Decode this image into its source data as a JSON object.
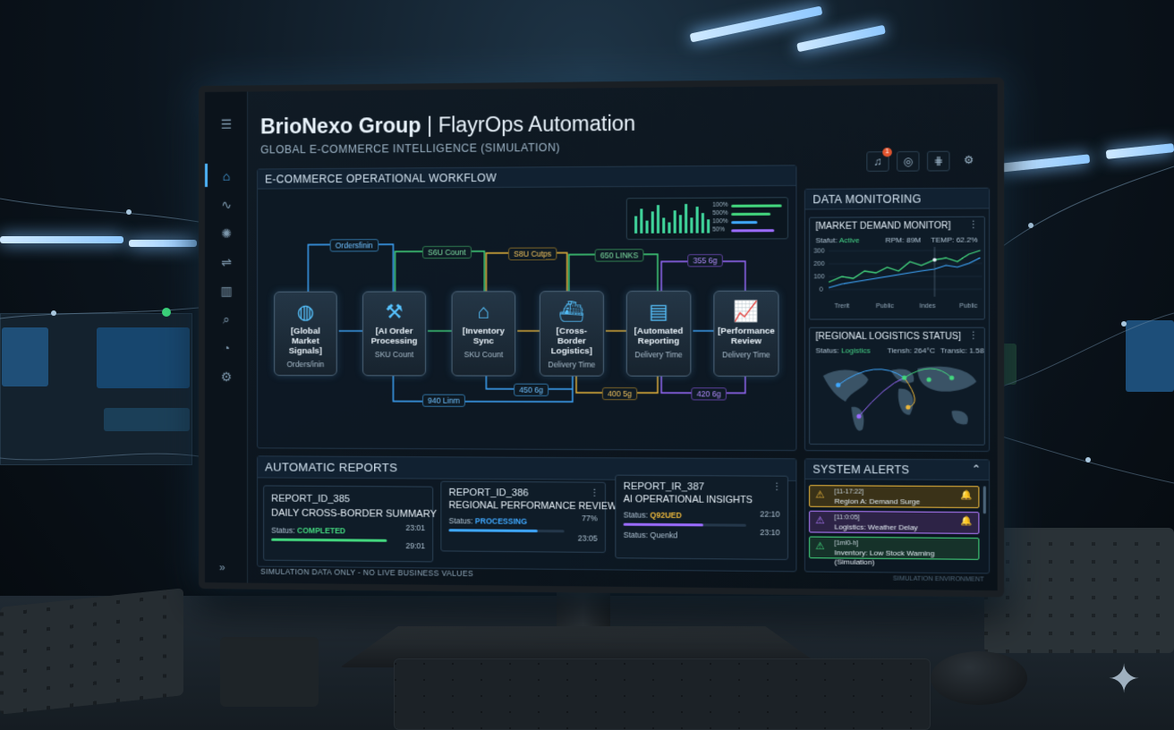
{
  "app": {
    "title_brand": "BrioNexo Group",
    "title_suffix": "| FlayrOps Automation",
    "subtitle": "GLOBAL E-COMMERCE INTELLIGENCE (SIMULATION)",
    "notification_count": "1"
  },
  "rail": {
    "items": [
      "menu-icon",
      "home-icon",
      "pulse-icon",
      "gear-network-icon",
      "sliders-icon",
      "bar-chart-icon",
      "search-icon",
      "gauge-icon",
      "settings-icon"
    ],
    "expand_label": "»"
  },
  "top_icons": [
    "bell-icon",
    "globe-icon",
    "grid-icon",
    "gear-icon"
  ],
  "workflow": {
    "title": "E-COMMERCE OPERATIONAL WORKFLOW",
    "nodes": [
      {
        "label": "[Global Market Signals]",
        "metric": "Orders/inin",
        "icon": "globe-icon"
      },
      {
        "label": "[AI Order Processing",
        "metric": "SKU Count",
        "icon": "robot-arm-icon"
      },
      {
        "label": "[Inventory Sync",
        "metric": "SKU Count",
        "icon": "warehouse-icon"
      },
      {
        "label": "[Cross-Border Logistics]",
        "metric": "Delivery Time",
        "icon": "ship-icon"
      },
      {
        "label": "[Automated Reporting",
        "metric": "Delivery Time",
        "icon": "report-gear-icon"
      },
      {
        "label": "[Performance Review",
        "metric": "Delivery Time",
        "icon": "trend-chart-icon"
      }
    ],
    "flow_labels": {
      "orders": "Ordersfinin",
      "sku_count": "S6U Count",
      "sku_cutps": "S8U Cutps",
      "links_650": "650 LINKS",
      "g355": "355 6g",
      "links_940": "940 Linm",
      "g450": "450 6g",
      "g400": "400 5g",
      "g420": "420 6g"
    },
    "mini_stats": [
      "100%",
      "500%",
      "100%",
      "50%"
    ],
    "mini_bar_levels": [
      0.55,
      0.8,
      0.4,
      0.7,
      0.9,
      0.5,
      0.35,
      0.75,
      0.6,
      0.95,
      0.5,
      0.85,
      0.65,
      0.45
    ],
    "colors": {
      "blue": "#3fa8ff",
      "green": "#43d77e",
      "yellow": "#e8b53b",
      "purple": "#9a6bff"
    }
  },
  "monitoring": {
    "title": "DATA MONITORING",
    "demand": {
      "title": "[MARKET DEMAND MONITOR]",
      "status_label": "Stafut:",
      "status_value": "Active",
      "rpm": "RPM: 89M",
      "temp": "TEMP: 62.2%",
      "y_ticks": [
        "300",
        "200",
        "100",
        "0"
      ],
      "x_ticks": [
        "Trerit",
        "Public",
        "Indes",
        "Public"
      ]
    },
    "logistics": {
      "title": "[REGIONAL LOGISTICS STATUS]",
      "status_label": "Status:",
      "status_value": "Logistics",
      "trend": "Tiensh: 264°C",
      "transit": "Transic: 1.58"
    }
  },
  "reports": {
    "title": "AUTOMATIC REPORTS",
    "items": [
      {
        "id": "REPORT_ID_385",
        "name": "DAILY CROSS-BORDER SUMMARY",
        "status_label": "Status:",
        "status": "COMPLETED",
        "time1": "23:01",
        "time2": "29:01",
        "progress": 1.0,
        "color": "#43d77e"
      },
      {
        "id": "REPORT_ID_386",
        "name": "REGIONAL PERFORMANCE REVIEW",
        "status_label": "Status:",
        "status": "PROCESSING",
        "time1": "77%",
        "time2": "23:05",
        "progress": 0.77,
        "color": "#3fa8ff"
      },
      {
        "id": "REPORT_IR_387",
        "name": "AI OPERATIONAL INSIGHTS",
        "status_label": "Status:",
        "status": "Q92UED",
        "time1": "22:10",
        "time2": "23:10",
        "progress": 0.65,
        "color": "#9a6bff",
        "status2": "Status: Quenkd"
      }
    ]
  },
  "alerts": {
    "title": "SYSTEM ALERTS",
    "items": [
      {
        "time": "[11-17:22]",
        "text": "Region A: Demand Surge",
        "color": "#e8b53b",
        "bg": "#3a3218"
      },
      {
        "time": "[11:0:05]",
        "text": "Logistics: Weather Delay",
        "color": "#b07bff",
        "bg": "#2d2346"
      },
      {
        "time": "[1ml0-h]",
        "text": "Inventory: Low Stock Warning (Simulation)",
        "color": "#43d77e",
        "bg": "#16322a"
      }
    ]
  },
  "footer": {
    "note": "SIMULATION DATA ONLY - NO LIVE BUSINESS VALUES",
    "right": "SIMULATION ENVIRONMENT"
  }
}
